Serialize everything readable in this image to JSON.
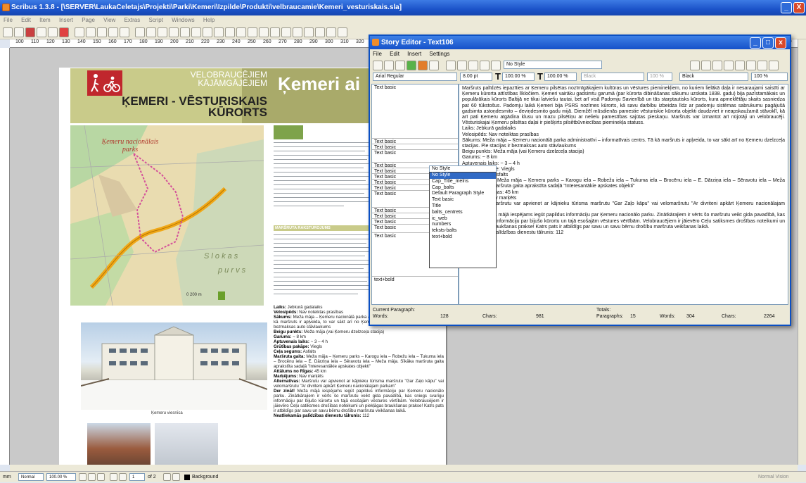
{
  "app": {
    "title": "Scribus 1.3.8 - [\\SERVER\\LaukaCeletajs\\Projekti\\Parki\\Kemeri\\Izpilde\\Produkti\\velbraucamie\\Kemeri_vesturiskais.sla]",
    "minimize": "_",
    "close": "X"
  },
  "menubar": [
    "File",
    "Edit",
    "Item",
    "Insert",
    "Page",
    "View",
    "Extras",
    "Script",
    "Windows",
    "Help"
  ],
  "ruler_h": [
    "100",
    "110",
    "120",
    "130",
    "140",
    "150",
    "160",
    "170",
    "180",
    "190",
    "200",
    "210",
    "220",
    "230",
    "240",
    "250",
    "260",
    "270",
    "280",
    "290",
    "300",
    "310",
    "320",
    "330",
    "340",
    "350",
    "620"
  ],
  "document": {
    "header_top": "VELOBRAUCĒJIEM KĀJĀMGĀJĒJIEM",
    "header_big": "Ķemeri ai",
    "header_sub": "ĶEMERI - VĒSTURISKAIS KŪRORTS",
    "map_title": "Ķemeru nacionālais parks",
    "map_slokas": "S l o k a s",
    "map_purvs": "p u r v s",
    "map_scale": "0     200 m",
    "section_head": "MARŠRUTA RAKSTUROJUMS",
    "photo_caption": "Ķemeru viesnīca",
    "info_lines": [
      {
        "label": "Laiks:",
        "text": " Jebkurā gadalaiks"
      },
      {
        "label": "Velosipēds:",
        "text": " Nav noteiktas prasības"
      },
      {
        "label": "Sākums:",
        "text": " Meža māja – Ķemeru nacionālā parka administratīvi – informatīvais centrs. Tā kā maršruts ir apļveida, to var sākt arī no Ķemeru dzelzceļa stacijas. Pie stacijas ir bezmaksas auto stāvlaukums"
      },
      {
        "label": "Beigu punkts:",
        "text": " Meža māja (vai Ķemeru dzelzceļa stacija)"
      },
      {
        "label": "Garums:",
        "text": " ~ 8 km"
      },
      {
        "label": "Aptuvenais laiks:",
        "text": " ~ 3 – 4 h"
      },
      {
        "label": "Grūtības pakāpe:",
        "text": " Viegls"
      },
      {
        "label": "Ceļa segums:",
        "text": " Asfalts"
      },
      {
        "label": "Maršruta gaita:",
        "text": " Meža māja – Ķemeru parks – Karogu iela – Robežu iela – Tukuma iela – Brocēnu iela – E. Dārziņa iela – Sēravotu iela – Meža māja. Sīkāka maršruta gaita aprakstīta sadaļā \"Interesantākie apskates objekti\""
      },
      {
        "label": "Attālums no Rīgas:",
        "text": " 45 km"
      },
      {
        "label": "Marķējums:",
        "text": " Nav marķēts"
      },
      {
        "label": "Alternatīvas:",
        "text": " Maršrutu var apvienot ar kājnieku tūrisma maršrutu \"Gar Zaļo kāpu\" vai velomaršrutu \"Ar divriteni apkārt Ķemeru nacionālajam parkam\""
      },
      {
        "label": "Der zināt!",
        "text": " Meža mājā iespējams iegūt papildus informāciju par Ķemeru nacionālo parku. Zinātkārajiem ir vērts šo maršrutu veikt gida pavadībā, kas sniegs svarīgu informāciju par bijušo kūrortu un tajā esošajām vēstures vērtībām. Velobraucējiem ir jāievēro Ceļu satiksmes drošības noteikumi un piekļāgas braukšanas prakse! Katrs pats ir atbildīgs par savu un savu bērnu drošību maršruta veikšanas laikā."
      },
      {
        "label": "Neatliekamās palīdzības dienestu tālrunis:",
        "text": " 112"
      }
    ]
  },
  "story_editor": {
    "title": "Story Editor - Text106",
    "menu": [
      "File",
      "Edit",
      "Insert",
      "Settings"
    ],
    "style_field": "No Style",
    "font_field": "Arial Regular",
    "size_field": "8.00 pt",
    "scale_w": "100.00 %",
    "scale_h": "100.00 %",
    "color1": "Black",
    "shade1": "100 %",
    "color2": "Black",
    "shade2": "100 %",
    "paragraph_styles": [
      "Text basic",
      "Text basic",
      "Text basic",
      "Text basic",
      "Text basic",
      "Text basic",
      "Text basic",
      "Text basic",
      "Text basic",
      "Text basic",
      "Text basic",
      "Text basic",
      "Text basic",
      "Text basic",
      "Text basic",
      "text+bold"
    ],
    "style_box_value": "No Style",
    "style_options": [
      "No Style",
      "Cap_Title_melns",
      "Cap_balts",
      "Default Paragraph Style",
      "Text basic",
      "Title",
      "balts_centrets",
      "ic_web",
      "numbers",
      "teksts-balts",
      "text+bold"
    ],
    "text_p1": "Maršruts palīdzēs iepazīties ar Ķemeru pilsētas nozīmīgākajiem kultūras un vēstures pieminekļiem, no kuriem lielākā daļa ir nesaraujami saistīti ar Ķemeru kūrorta attīstības līkločiem. Ķemeri vairāku gadsimtu garumā (par kūrorta dibināšanas sākumu uzskata 1838. gadu) bija pazīstamākais un populārākais kūrorts Baltijā ne tikai latviešu tautai, bet arī visā Padomju Savienībā un tās starptautisks kūrorts, kura apmeklētāju skaits sasniedza pat 60 tūkstošus. Padomju laikā Ķemeri bija PSRS nozīmes kūrorts, kā savu darbību izbeidza līdz ar padomju sistēmas sabrukumu pagājušā gadsimta astoņdesmito – deviņdesmito gadu mijā. Diemžēl mūsdienās pamestie vēsturiskie kūrorta objekti daudzviet ir neapskaužamā stāvoklī, kā arī pati Ķemeru atgādina klusu un mazu pilsētiņu ar nelielu pamestības sajūtas pieskaņu. Maršruts var izmantot arī nūjotāji un velobraucēji. Vēsturiskajai Ķemeru pilsētas daļai ir piešķirts pilsētbūvniecības pieminekļa statuss.",
    "text_p2": "Laiks: Jebkurā gadalaiks",
    "text_p3": "Velosipēds: Nav noteiktas prasības",
    "text_p4": "Sākums: Meža māja – Ķemeru nacionālā parka administratīvi – informatīvais centrs. Tā kā maršruts ir apļveida, to var sākt arī no Ķemeru dzelzceļa stacijas. Pie stacijas ir bezmaksas auto stāvlaukums",
    "text_p5": "Beigu punkts: Meža māja (vai Ķemeru dzelzceļa stacija)",
    "text_p6": "Garums: ~ 8 km",
    "text_p7": "Aptuvenais laiks: ~ 3 – 4 h",
    "text_p8": "Grūtības pakāpe: Viegls",
    "text_p9": "Ceļa segums: Asfalts",
    "text_p10": "Maršruta gaita: Meža māja – Ķemeru parks – Karogu iela – Robežu iela – Tukuma iela – Brocēnu iela – E. Dārziņa iela – Sēravotu iela – Meža māja. Sīkāka maršruta gaita aprakstīta sadaļā \"Interesantākie apskates objekti\"",
    "text_p11": "Attālums no Rīgas: 45 km",
    "text_p12": "Marķējums: Nav marķēts",
    "text_p13": "Alternatīvas: Maršrutu var apvienot ar kājnieku tūrisma maršrutu \"Gar Zaļo kāpu\" vai velomaršrutu \"Ar divriteni apkārt Ķemeru nacionālajam parkam\"",
    "text_p14": "Der zināt! Meža mājā iespējams iegūt papildus informāciju par Ķemeru nacionālo parku. Zinātkārajiem ir vērts šo maršrutu veikt gida pavadībā, kas sniegs svarīgu informāciju par bijušo kūrortu un tajā esošajām vēstures vērtībām. Velobraucējiem ir jāievēro Ceļu satiksmes drošības noteikumi un piesardzīgas braukšanas prakse! Katrs pats ir atbildīgs par savu un savu bērnu drošību maršruta veikšanas laikā.",
    "text_p15": "Neatliekamās palīdzības dienestu tālrunis: 112",
    "status_current": "Current Paragraph:",
    "status_words_label": "Words:",
    "status_words": "128",
    "status_chars_label": "Chars:",
    "status_chars": "981",
    "status_totals": "Totals:",
    "status_paragraphs_label": "Paragraphs:",
    "status_paragraphs": "15",
    "status_twords_label": "Words:",
    "status_twords": "304",
    "status_tchars_label": "Chars:",
    "status_tchars": "2264"
  },
  "statusbar": {
    "unit": "mm",
    "mode": "Normal",
    "zoom": "100.00 %",
    "page": "1",
    "page_of": "of 2",
    "layer": "Background",
    "right_mode": "Normal Vision"
  },
  "colors": {
    "title_blue": "#1b53c9",
    "header_olive": "#c9cb8a",
    "logo_red": "#c0272d",
    "selection_blue": "#316ac5"
  }
}
